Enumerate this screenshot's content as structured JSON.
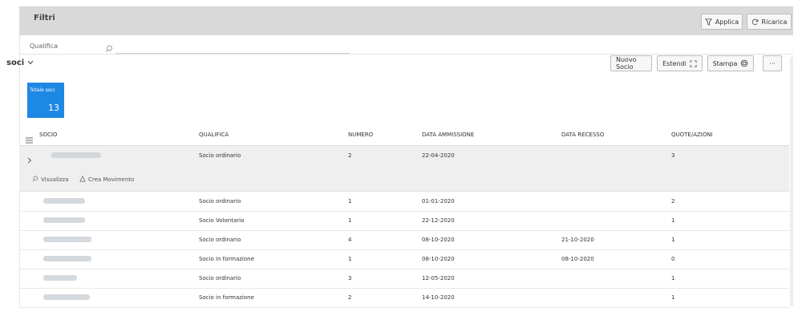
{
  "filters": {
    "title": "Filtri",
    "apply_label": "Applica",
    "reload_label": "Ricarica",
    "qualifica_label": "Qualifica"
  },
  "section": {
    "title": "soci"
  },
  "toolbar": {
    "new_label": "Nuovo Socio",
    "expand_label": "Estendi",
    "print_label": "Stampa",
    "more_label": "···"
  },
  "stat": {
    "label": "Totale soci",
    "value": "13"
  },
  "table": {
    "columns": [
      "SOCIO",
      "QUALIFICA",
      "NUMERO",
      "DATA AMMISSIONE",
      "DATA RECESSO",
      "QUOTE/AZIONI"
    ],
    "expanded_actions": {
      "view_label": "Visualizza",
      "movement_label": "Crea Movimento"
    },
    "rows": [
      {
        "qualifica": "Socio ordinario",
        "numero": "2",
        "data_ammissione": "22-04-2020",
        "data_recesso": "",
        "quote": "3"
      },
      {
        "qualifica": "Socio ordinario",
        "numero": "1",
        "data_ammissione": "01-01-2020",
        "data_recesso": "",
        "quote": "2"
      },
      {
        "qualifica": "Socio Volontario",
        "numero": "1",
        "data_ammissione": "22-12-2020",
        "data_recesso": "",
        "quote": "1"
      },
      {
        "qualifica": "Socio ordinario",
        "numero": "4",
        "data_ammissione": "08-10-2020",
        "data_recesso": "21-10-2020",
        "quote": "1"
      },
      {
        "qualifica": "Socio in formazione",
        "numero": "1",
        "data_ammissione": "08-10-2020",
        "data_recesso": "08-10-2020",
        "quote": "0"
      },
      {
        "qualifica": "Socio ordinario",
        "numero": "3",
        "data_ammissione": "12-05-2020",
        "data_recesso": "",
        "quote": "1"
      },
      {
        "qualifica": "Socio in formazione",
        "numero": "2",
        "data_ammissione": "14-10-2020",
        "data_recesso": "",
        "quote": "1"
      }
    ]
  },
  "icons": {
    "filter": "filter-icon",
    "reload": "refresh-icon",
    "search": "search-icon",
    "expand": "expand-icon",
    "print": "printer-icon",
    "menu": "menu-icon",
    "chevron": "chevron-right-icon"
  },
  "colors": {
    "tile": "#1e88e5",
    "filter_bar": "#d9d9d9",
    "expanded_row": "#efefef"
  }
}
